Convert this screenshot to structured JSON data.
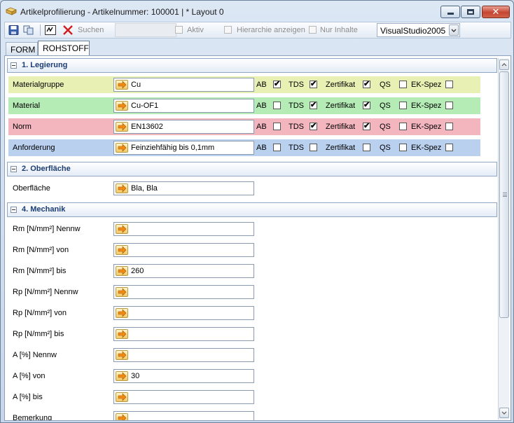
{
  "window": {
    "title": "Artikelprofilierung  -  Artikelnummer: 100001 | * Layout 0"
  },
  "toolbar": {
    "search_label": "Suchen",
    "aktiv_label": "Aktiv",
    "hierarchie_label": "Hierarchie anzeigen",
    "nur_inhalte_label": "Nur Inhalte",
    "theme_value": "VisualStudio2005"
  },
  "tabs": [
    "FORM",
    "ROHSTOFF"
  ],
  "sections": {
    "legierung": "1. Legierung",
    "oberflaeche": "2. Oberfläche",
    "mechanik": "4. Mechanik"
  },
  "flags": [
    "AB",
    "TDS",
    "Zertifikat",
    "QS",
    "EK-Spez"
  ],
  "legierung_rows": [
    {
      "label": "Materialgruppe",
      "value": "Cu",
      "color": "#e8f1b3",
      "checks": [
        true,
        true,
        true,
        false,
        false
      ]
    },
    {
      "label": "Material",
      "value": "Cu-OF1",
      "color": "#b5ecb5",
      "checks": [
        false,
        true,
        true,
        false,
        false
      ]
    },
    {
      "label": "Norm",
      "value": "EN13602",
      "color": "#f3b6bf",
      "checks": [
        false,
        true,
        true,
        false,
        false
      ]
    },
    {
      "label": "Anforderung",
      "value": "Feinziehfähig bis 0,1mm",
      "color": "#b9d0ef",
      "checks": [
        false,
        false,
        false,
        false,
        false
      ]
    }
  ],
  "oberflaeche_rows": [
    {
      "label": "Oberfläche",
      "value": "Bla, Bla"
    }
  ],
  "mechanik_rows": [
    {
      "label": "Rm [N/mm²] Nennw",
      "value": ""
    },
    {
      "label": "Rm [N/mm²] von",
      "value": ""
    },
    {
      "label": "Rm [N/mm²] bis",
      "value": "260"
    },
    {
      "label": "Rp [N/mm²] Nennw",
      "value": ""
    },
    {
      "label": "Rp [N/mm²] von",
      "value": ""
    },
    {
      "label": "Rp [N/mm²] bis",
      "value": ""
    },
    {
      "label": "A [%] Nennw",
      "value": ""
    },
    {
      "label": "A [%] von",
      "value": "30"
    },
    {
      "label": "A [%] bis",
      "value": ""
    },
    {
      "label": "Bemerkung",
      "value": ""
    }
  ]
}
